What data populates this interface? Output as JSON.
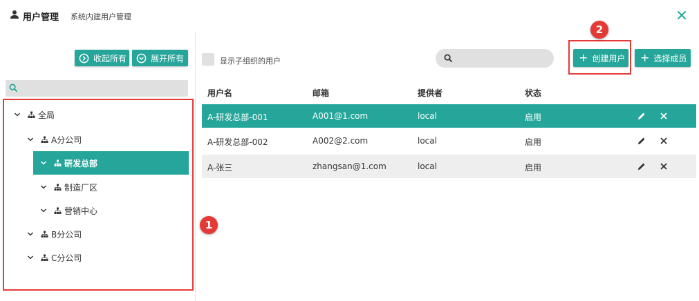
{
  "header": {
    "title": "用户管理",
    "subtitle": "系统内建用户管理"
  },
  "tree_panel": {
    "collapse_all_label": "收起所有",
    "expand_all_label": "展开所有",
    "search_value": "",
    "nodes": [
      {
        "label": "全局",
        "level": 0,
        "selected": false
      },
      {
        "label": "A分公司",
        "level": 1,
        "selected": false
      },
      {
        "label": "研发总部",
        "level": 2,
        "selected": true
      },
      {
        "label": "制造厂区",
        "level": 2,
        "selected": false
      },
      {
        "label": "营销中心",
        "level": 2,
        "selected": false
      },
      {
        "label": "B分公司",
        "level": 1,
        "selected": false
      },
      {
        "label": "C分公司",
        "level": 1,
        "selected": false
      }
    ]
  },
  "annotations": {
    "badge_1": "1",
    "badge_2": "2",
    "highlight_color": "#e53935"
  },
  "user_panel": {
    "show_sub_org_label": "显示子组织的用户",
    "show_sub_org_checked": false,
    "search_value": "",
    "create_user_label": "创建用户",
    "select_member_label": "选择成员",
    "columns": [
      "用户名",
      "邮箱",
      "提供者",
      "状态"
    ],
    "rows": [
      {
        "username": "A-研发总部-001",
        "email": "A001@1.com",
        "provider": "local",
        "status": "启用",
        "selected": true
      },
      {
        "username": "A-研发总部-002",
        "email": "A002@2.com",
        "provider": "local",
        "status": "启用",
        "selected": false
      },
      {
        "username": "A-张三",
        "email": "zhangsan@1.com",
        "provider": "local",
        "status": "启用",
        "selected": false
      }
    ]
  },
  "colors": {
    "accent": "#26a69a",
    "field_bg": "#e0e0e0"
  }
}
